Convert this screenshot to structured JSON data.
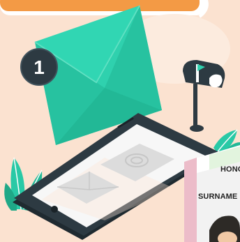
{
  "illustration": {
    "notification_badge": "1",
    "card_labels": {
      "honor": "HONO",
      "surname": "SURNAME"
    }
  },
  "colors": {
    "background": "#fbe2d0",
    "top_banner": "#f39a45",
    "envelope": "#2fd1ae",
    "envelope_shade": "#22b896",
    "tablet_frame": "#2d3a42",
    "tablet_screen": "#f7f7f7",
    "plant": "#29c9a6",
    "id_card": "#eaeaea",
    "id_card_pink": "#ecbcc9",
    "mailbox": "#2d3a42"
  },
  "icons": [
    "envelope-icon",
    "notification-badge",
    "mailbox-icon",
    "tablet-device",
    "plant-leaves",
    "id-card"
  ]
}
